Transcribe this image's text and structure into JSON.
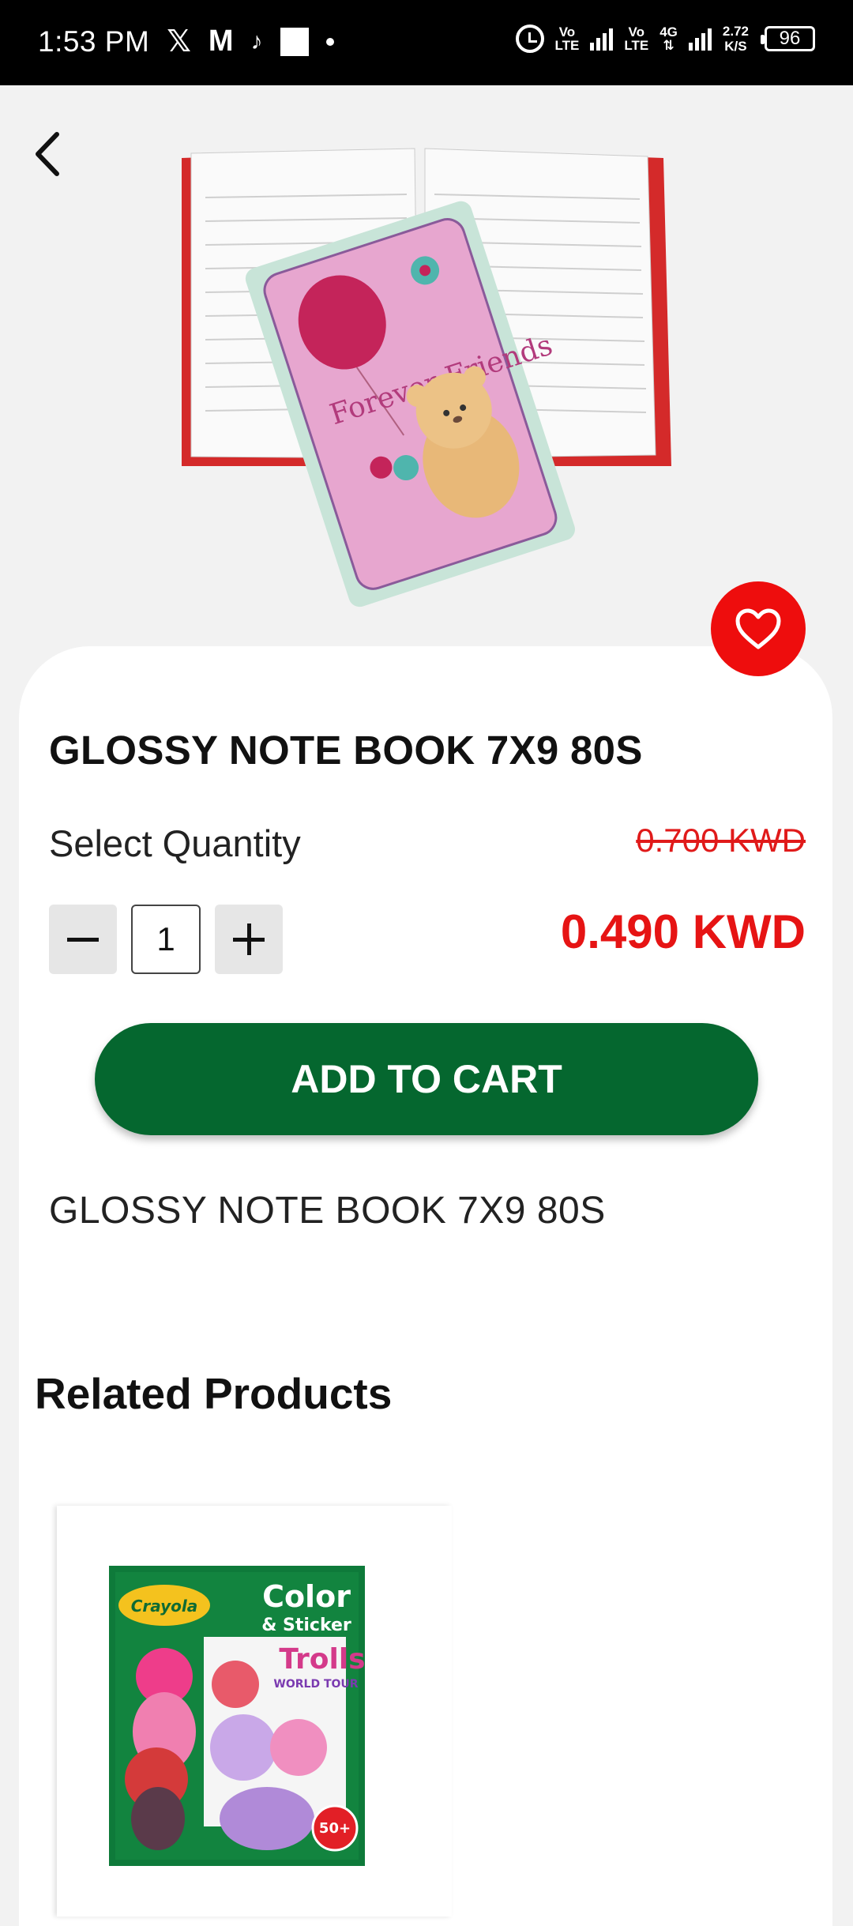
{
  "status_bar": {
    "time": "1:53 PM",
    "network_top": "Vo",
    "network_bottom": "LTE",
    "network2_top": "Vo",
    "network2_bottom": "LTE",
    "network_type": "4G",
    "speed_value": "2.72",
    "speed_unit": "K/S",
    "battery": "96"
  },
  "product": {
    "title": "GLOSSY NOTE BOOK 7X9 80S",
    "quantity_label": "Select Quantity",
    "old_price": "0.700 KWD",
    "new_price": "0.490 KWD",
    "quantity": "1",
    "add_to_cart_label": "ADD TO CART",
    "description": "GLOSSY NOTE BOOK 7X9 80S",
    "image_text": "Forever Friends"
  },
  "related": {
    "heading": "Related Products",
    "items": [
      {
        "brand": "Crayola",
        "title_line1": "Color",
        "title_line2": "& Sticker",
        "series": "Trolls",
        "subtitle": "WORLD TOUR",
        "badge": "50+"
      }
    ]
  },
  "colors": {
    "accent_green": "#05672f",
    "price_red": "#e61414",
    "favorite_red": "#ee0d0d"
  }
}
